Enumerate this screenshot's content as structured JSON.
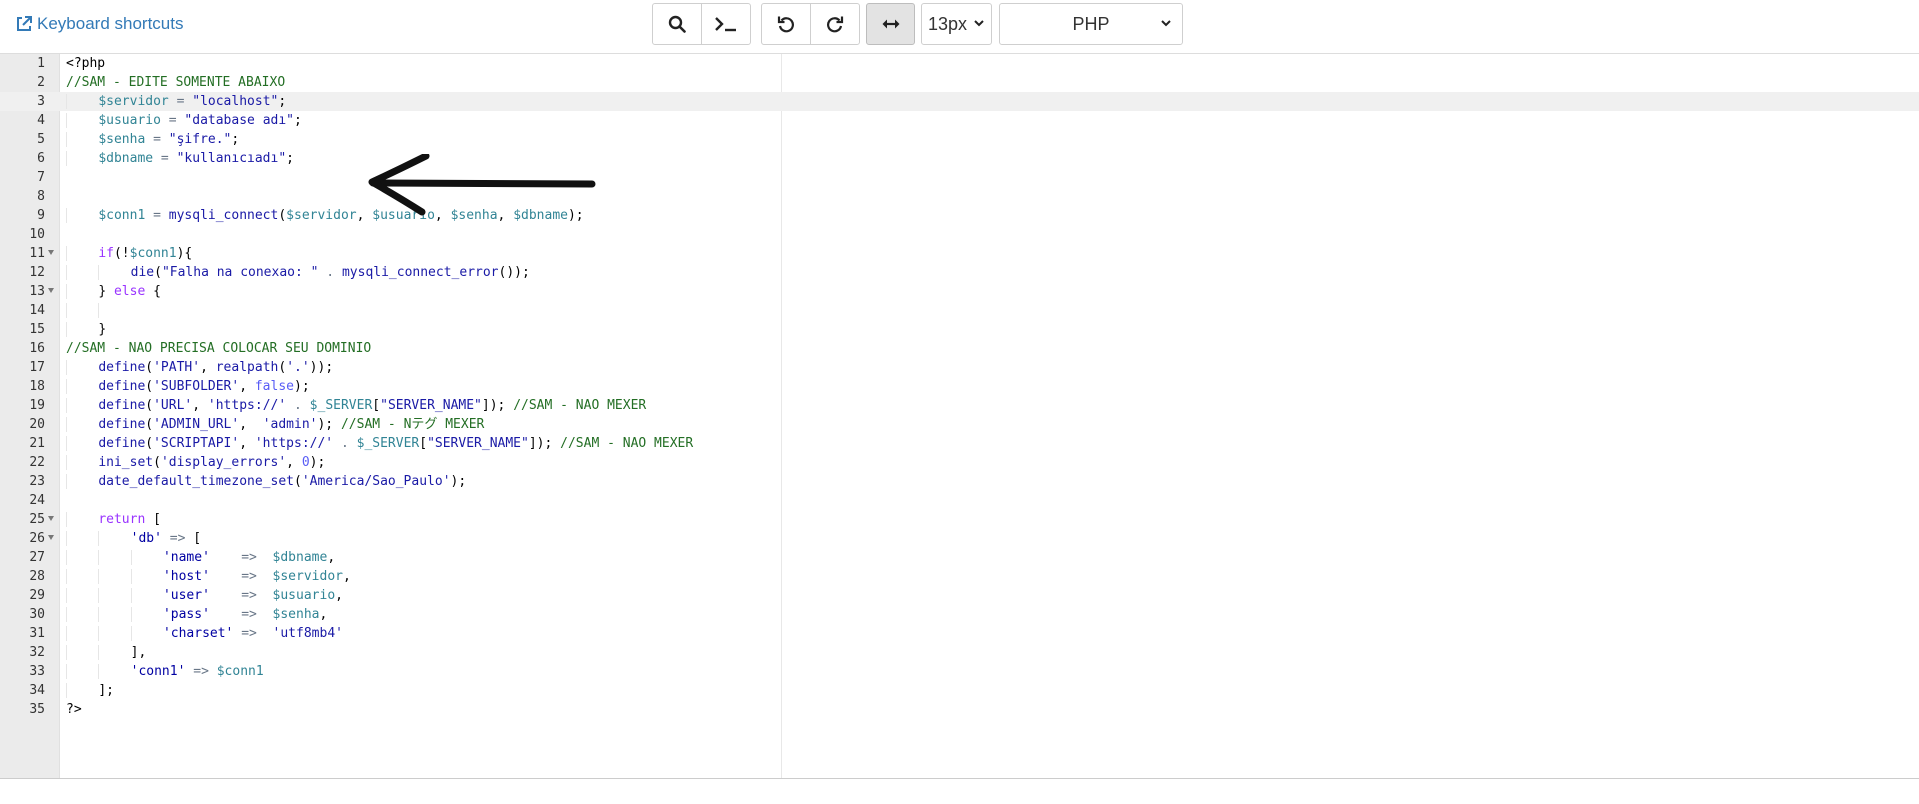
{
  "toolbar": {
    "shortcuts_label": "Keyboard shortcuts",
    "font_size": "13px",
    "language": "PHP"
  },
  "editor": {
    "lines": [
      {
        "n": "1",
        "fold": false,
        "tokens": [
          [
            "tag",
            "<?php"
          ]
        ]
      },
      {
        "n": "2",
        "fold": false,
        "tokens": [
          [
            "comment",
            "//SAM - EDITE SOMENTE ABAIXO"
          ]
        ]
      },
      {
        "n": "3",
        "fold": false,
        "tokens": [
          [
            "ws",
            "    "
          ],
          [
            "var",
            "$servidor"
          ],
          [
            "op",
            " = "
          ],
          [
            "str",
            "\"localhost\""
          ],
          [
            "txt",
            ";"
          ]
        ]
      },
      {
        "n": "4",
        "fold": false,
        "tokens": [
          [
            "ws",
            "    "
          ],
          [
            "var",
            "$usuario"
          ],
          [
            "op",
            " = "
          ],
          [
            "str",
            "\"database adı\""
          ],
          [
            "txt",
            ";"
          ]
        ]
      },
      {
        "n": "5",
        "fold": false,
        "tokens": [
          [
            "ws",
            "    "
          ],
          [
            "var",
            "$senha"
          ],
          [
            "op",
            " = "
          ],
          [
            "str",
            "\"şifre.\""
          ],
          [
            "txt",
            ";"
          ]
        ]
      },
      {
        "n": "6",
        "fold": false,
        "tokens": [
          [
            "ws",
            "    "
          ],
          [
            "var",
            "$dbname"
          ],
          [
            "op",
            " = "
          ],
          [
            "str",
            "\"kullanıcıadı\""
          ],
          [
            "txt",
            ";"
          ]
        ]
      },
      {
        "n": "7",
        "fold": false,
        "tokens": []
      },
      {
        "n": "8",
        "fold": false,
        "tokens": []
      },
      {
        "n": "9",
        "fold": false,
        "tokens": [
          [
            "ws",
            "    "
          ],
          [
            "var",
            "$conn1"
          ],
          [
            "op",
            " = "
          ],
          [
            "fn",
            "mysqli_connect"
          ],
          [
            "txt",
            "("
          ],
          [
            "var",
            "$servidor"
          ],
          [
            "txt",
            ", "
          ],
          [
            "var",
            "$usuario"
          ],
          [
            "txt",
            ", "
          ],
          [
            "var",
            "$senha"
          ],
          [
            "txt",
            ", "
          ],
          [
            "var",
            "$dbname"
          ],
          [
            "txt",
            ");"
          ]
        ]
      },
      {
        "n": "10",
        "fold": false,
        "tokens": []
      },
      {
        "n": "11",
        "fold": true,
        "tokens": [
          [
            "ws",
            "    "
          ],
          [
            "kw",
            "if"
          ],
          [
            "txt",
            "(!"
          ],
          [
            "var",
            "$conn1"
          ],
          [
            "txt",
            "){"
          ]
        ]
      },
      {
        "n": "12",
        "fold": false,
        "tokens": [
          [
            "ws",
            "    "
          ],
          [
            "ws",
            "    "
          ],
          [
            "fn",
            "die"
          ],
          [
            "txt",
            "("
          ],
          [
            "str",
            "\"Falha na conexao: \""
          ],
          [
            "op",
            " . "
          ],
          [
            "fn",
            "mysqli_connect_error"
          ],
          [
            "txt",
            "());"
          ]
        ]
      },
      {
        "n": "13",
        "fold": true,
        "tokens": [
          [
            "ws",
            "    "
          ],
          [
            "txt",
            "} "
          ],
          [
            "kw",
            "else"
          ],
          [
            "txt",
            " {"
          ]
        ]
      },
      {
        "n": "14",
        "fold": false,
        "tokens": [
          [
            "ws",
            "    "
          ],
          [
            "ws",
            "    "
          ]
        ]
      },
      {
        "n": "15",
        "fold": false,
        "tokens": [
          [
            "ws",
            "    "
          ],
          [
            "txt",
            "}"
          ]
        ]
      },
      {
        "n": "16",
        "fold": false,
        "tokens": [
          [
            "comment",
            "//SAM - NAO PRECISA COLOCAR SEU DOMINIO"
          ]
        ]
      },
      {
        "n": "17",
        "fold": false,
        "tokens": [
          [
            "ws",
            "    "
          ],
          [
            "fn",
            "define"
          ],
          [
            "txt",
            "("
          ],
          [
            "str",
            "'PATH'"
          ],
          [
            "txt",
            ", "
          ],
          [
            "fn",
            "realpath"
          ],
          [
            "txt",
            "("
          ],
          [
            "str",
            "'.'"
          ],
          [
            "txt",
            "));"
          ]
        ]
      },
      {
        "n": "18",
        "fold": false,
        "tokens": [
          [
            "ws",
            "    "
          ],
          [
            "fn",
            "define"
          ],
          [
            "txt",
            "("
          ],
          [
            "str",
            "'SUBFOLDER'"
          ],
          [
            "txt",
            ", "
          ],
          [
            "const",
            "false"
          ],
          [
            "txt",
            ");"
          ]
        ]
      },
      {
        "n": "19",
        "fold": false,
        "tokens": [
          [
            "ws",
            "    "
          ],
          [
            "fn",
            "define"
          ],
          [
            "txt",
            "("
          ],
          [
            "str",
            "'URL'"
          ],
          [
            "txt",
            ", "
          ],
          [
            "str",
            "'https://'"
          ],
          [
            "op",
            " . "
          ],
          [
            "var",
            "$_SERVER"
          ],
          [
            "txt",
            "["
          ],
          [
            "str",
            "\"SERVER_NAME\""
          ],
          [
            "txt",
            "]); "
          ],
          [
            "comment",
            "//SAM - NAO MEXER"
          ]
        ]
      },
      {
        "n": "20",
        "fold": false,
        "tokens": [
          [
            "ws",
            "    "
          ],
          [
            "fn",
            "define"
          ],
          [
            "txt",
            "("
          ],
          [
            "str",
            "'ADMIN_URL'"
          ],
          [
            "txt",
            ",  "
          ],
          [
            "str",
            "'admin'"
          ],
          [
            "txt",
            "); "
          ],
          [
            "comment",
            "//SAM - Nテグ MEXER"
          ]
        ]
      },
      {
        "n": "21",
        "fold": false,
        "tokens": [
          [
            "ws",
            "    "
          ],
          [
            "fn",
            "define"
          ],
          [
            "txt",
            "("
          ],
          [
            "str",
            "'SCRIPTAPI'"
          ],
          [
            "txt",
            ", "
          ],
          [
            "str",
            "'https://'"
          ],
          [
            "op",
            " . "
          ],
          [
            "var",
            "$_SERVER"
          ],
          [
            "txt",
            "["
          ],
          [
            "str",
            "\"SERVER_NAME\""
          ],
          [
            "txt",
            "]); "
          ],
          [
            "comment",
            "//SAM - NAO MEXER"
          ]
        ]
      },
      {
        "n": "22",
        "fold": false,
        "tokens": [
          [
            "ws",
            "    "
          ],
          [
            "fn",
            "ini_set"
          ],
          [
            "txt",
            "("
          ],
          [
            "str",
            "'display_errors'"
          ],
          [
            "txt",
            ", "
          ],
          [
            "const",
            "0"
          ],
          [
            "txt",
            ");"
          ]
        ]
      },
      {
        "n": "23",
        "fold": false,
        "tokens": [
          [
            "ws",
            "    "
          ],
          [
            "fn",
            "date_default_timezone_set"
          ],
          [
            "txt",
            "("
          ],
          [
            "str",
            "'America/Sao_Paulo'"
          ],
          [
            "txt",
            ");"
          ]
        ]
      },
      {
        "n": "24",
        "fold": false,
        "tokens": []
      },
      {
        "n": "25",
        "fold": true,
        "tokens": [
          [
            "ws",
            "    "
          ],
          [
            "kw",
            "return"
          ],
          [
            "txt",
            " ["
          ]
        ]
      },
      {
        "n": "26",
        "fold": true,
        "tokens": [
          [
            "ws",
            "    "
          ],
          [
            "ws",
            "    "
          ],
          [
            "key",
            "'db'"
          ],
          [
            "op",
            " => "
          ],
          [
            "txt",
            "["
          ]
        ]
      },
      {
        "n": "27",
        "fold": false,
        "tokens": [
          [
            "ws",
            "    "
          ],
          [
            "ws",
            "    "
          ],
          [
            "ws",
            "    "
          ],
          [
            "key",
            "'name'"
          ],
          [
            "op",
            "    =>  "
          ],
          [
            "var",
            "$dbname"
          ],
          [
            "txt",
            ","
          ]
        ]
      },
      {
        "n": "28",
        "fold": false,
        "tokens": [
          [
            "ws",
            "    "
          ],
          [
            "ws",
            "    "
          ],
          [
            "ws",
            "    "
          ],
          [
            "key",
            "'host'"
          ],
          [
            "op",
            "    =>  "
          ],
          [
            "var",
            "$servidor"
          ],
          [
            "txt",
            ","
          ]
        ]
      },
      {
        "n": "29",
        "fold": false,
        "tokens": [
          [
            "ws",
            "    "
          ],
          [
            "ws",
            "    "
          ],
          [
            "ws",
            "    "
          ],
          [
            "key",
            "'user'"
          ],
          [
            "op",
            "    =>  "
          ],
          [
            "var",
            "$usuario"
          ],
          [
            "txt",
            ","
          ]
        ]
      },
      {
        "n": "30",
        "fold": false,
        "tokens": [
          [
            "ws",
            "    "
          ],
          [
            "ws",
            "    "
          ],
          [
            "ws",
            "    "
          ],
          [
            "key",
            "'pass'"
          ],
          [
            "op",
            "    =>  "
          ],
          [
            "var",
            "$senha"
          ],
          [
            "txt",
            ","
          ]
        ]
      },
      {
        "n": "31",
        "fold": false,
        "tokens": [
          [
            "ws",
            "    "
          ],
          [
            "ws",
            "    "
          ],
          [
            "ws",
            "    "
          ],
          [
            "key",
            "'charset'"
          ],
          [
            "op",
            " =>  "
          ],
          [
            "str",
            "'utf8mb4'"
          ]
        ]
      },
      {
        "n": "32",
        "fold": false,
        "tokens": [
          [
            "ws",
            "    "
          ],
          [
            "ws",
            "    "
          ],
          [
            "txt",
            "],"
          ]
        ]
      },
      {
        "n": "33",
        "fold": false,
        "tokens": [
          [
            "ws",
            "    "
          ],
          [
            "ws",
            "    "
          ],
          [
            "key",
            "'conn1'"
          ],
          [
            "op",
            " => "
          ],
          [
            "var",
            "$conn1"
          ]
        ]
      },
      {
        "n": "34",
        "fold": false,
        "tokens": [
          [
            "ws",
            "    "
          ],
          [
            "txt",
            "];"
          ]
        ]
      },
      {
        "n": "35",
        "fold": false,
        "tokens": [
          [
            "tag",
            "?>"
          ]
        ]
      }
    ]
  }
}
